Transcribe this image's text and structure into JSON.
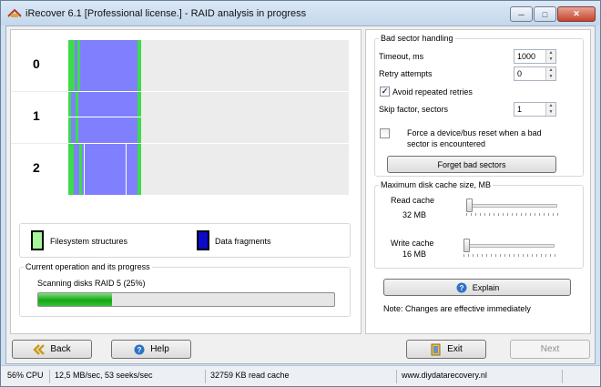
{
  "window": {
    "title": "iRecover 6.1 [Professional license.] - RAID analysis in progress"
  },
  "disk_map": {
    "disks": [
      {
        "label": "0"
      },
      {
        "label": "1"
      },
      {
        "label": "2"
      }
    ],
    "colors": {
      "filesystem": "#3ddb4a",
      "data": "#8080ff",
      "empty": "#ececec"
    }
  },
  "legend": {
    "filesystem_label": "Filesystem structures",
    "data_label": "Data fragments"
  },
  "progress": {
    "group_title": "Current operation and its progress",
    "status": "Scanning disks RAID 5 (25%)",
    "fraction": 0.25
  },
  "bad_sector": {
    "group_title": "Bad sector handling",
    "timeout_label": "Timeout, ms",
    "timeout_value": "1000",
    "retry_label": "Retry attempts",
    "retry_value": "0",
    "avoid_label": "Avoid repeated retries",
    "avoid_checked": true,
    "skip_label": "Skip factor, sectors",
    "skip_value": "1",
    "reset_label_line1": "Force a device/bus reset when a bad",
    "reset_label_line2": "sector is encountered",
    "reset_checked": false,
    "forget_button": "Forget bad sectors"
  },
  "cache": {
    "group_title": "Maximum disk cache size, MB",
    "read_label": "Read cache",
    "read_value": "32 MB",
    "write_label": "Write cache",
    "write_value": "16 MB"
  },
  "explain_button": "Explain",
  "note": "Note: Changes are effective immediately",
  "nav": {
    "back": "Back",
    "help": "Help",
    "exit": "Exit",
    "next": "Next"
  },
  "statusbar": {
    "cpu": "56% CPU",
    "speed": "12,5 MB/sec, 53 seeks/sec",
    "cache": "32759 KB read cache",
    "url": "www.diydatarecovery.nl"
  }
}
